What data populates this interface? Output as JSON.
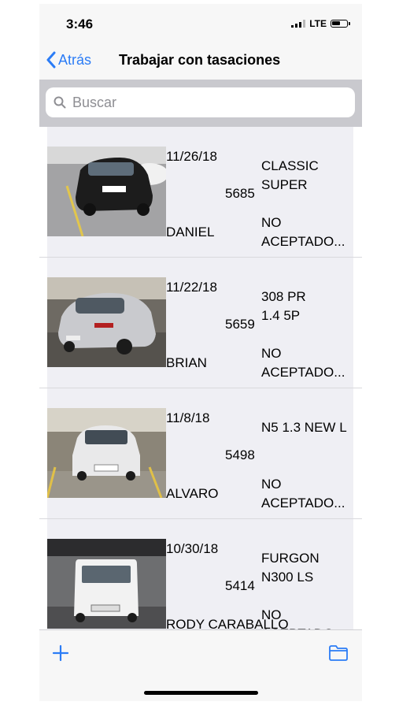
{
  "status_bar": {
    "time": "3:46",
    "network": "LTE"
  },
  "nav": {
    "back_label": "Atrás",
    "title": "Trabajar con tasaciones"
  },
  "search": {
    "placeholder": "Buscar"
  },
  "rows": [
    {
      "date": "11/26/18",
      "number": "5685",
      "name": "DANIEL",
      "model": "CLASSIC\nSUPER",
      "status": "NO\nACEPTADO...",
      "car_color": "#1c1c1c"
    },
    {
      "date": "11/22/18",
      "number": "5659",
      "name": "BRIAN",
      "model": "308 PR\n1.4 5P",
      "status": "NO\nACEPTADO...",
      "car_color": "#c9cace"
    },
    {
      "date": "11/8/18",
      "number": "5498",
      "name": "ALVARO",
      "model": "N5 1.3 NEW L",
      "status": "NO\nACEPTADO...",
      "car_color": "#e9e9ea"
    },
    {
      "date": "10/30/18",
      "number": "5414",
      "name": "RODY CARABALLO",
      "model": "FURGON\nN300 LS",
      "status": "NO\nACEPTADO...",
      "car_color": "#f2f2f2"
    }
  ],
  "toolbar": {
    "add_icon": "plus-icon",
    "folder_icon": "folder-icon",
    "accent": "#2b7cf6"
  }
}
